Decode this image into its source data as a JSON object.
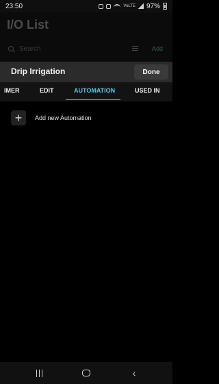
{
  "status_bar": {
    "time": "23:50",
    "battery_percent": "97%",
    "network_label": "VoLTE"
  },
  "background_screen": {
    "title": "I/O List",
    "search_placeholder": "Search",
    "add_label": "Add"
  },
  "sheet": {
    "title": "Drip Irrigation",
    "done_label": "Done"
  },
  "tabs": [
    {
      "label": "IMER",
      "active": false
    },
    {
      "label": "EDIT",
      "active": false
    },
    {
      "label": "AUTOMATION",
      "active": true
    },
    {
      "label": "USED IN",
      "active": false
    }
  ],
  "content": {
    "add_automation_label": "Add new Automation",
    "plus_symbol": "+"
  },
  "nav": {
    "back_glyph": "‹"
  },
  "colors": {
    "accent": "#4fc8ea",
    "sheet_header_bg": "#2b2b2b"
  }
}
